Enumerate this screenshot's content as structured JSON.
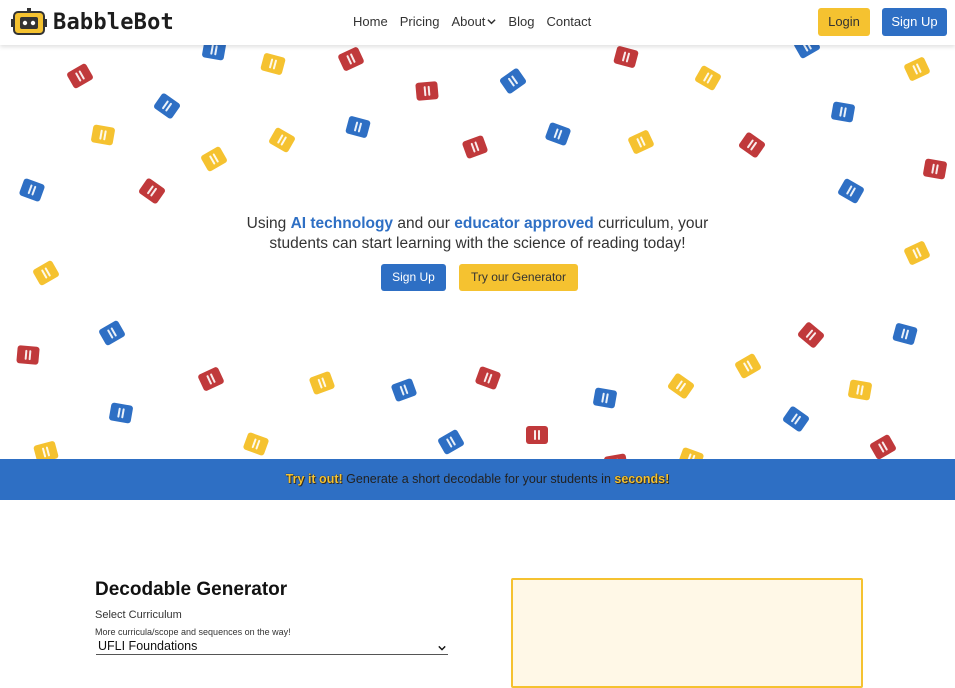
{
  "header": {
    "brand": "BabbleBot",
    "nav": [
      "Home",
      "Pricing",
      "About",
      "Blog",
      "Contact"
    ],
    "login": "Login",
    "signup": "Sign Up"
  },
  "hero": {
    "line1_a": "Using ",
    "line1_hl1": "AI technology",
    "line1_b": " and our ",
    "line1_hl2": "educator approved",
    "line1_c": " curriculum, your",
    "line2": "students can start learning with the science of reading today!",
    "btn_signup": "Sign Up",
    "btn_generator": "Try our Generator"
  },
  "banner": {
    "em1": "Try it out!",
    "mid": " Generate a short decodable for your students in ",
    "em2": "seconds!"
  },
  "generator": {
    "title": "Decodable Generator",
    "label": "Select Curriculum",
    "note": "More curricula/scope and sequences on the way!",
    "selected": "UFLI Foundations"
  },
  "colors": {
    "blue": "#2e6fc4",
    "yellow": "#f5c230",
    "red": "#c0393b"
  }
}
